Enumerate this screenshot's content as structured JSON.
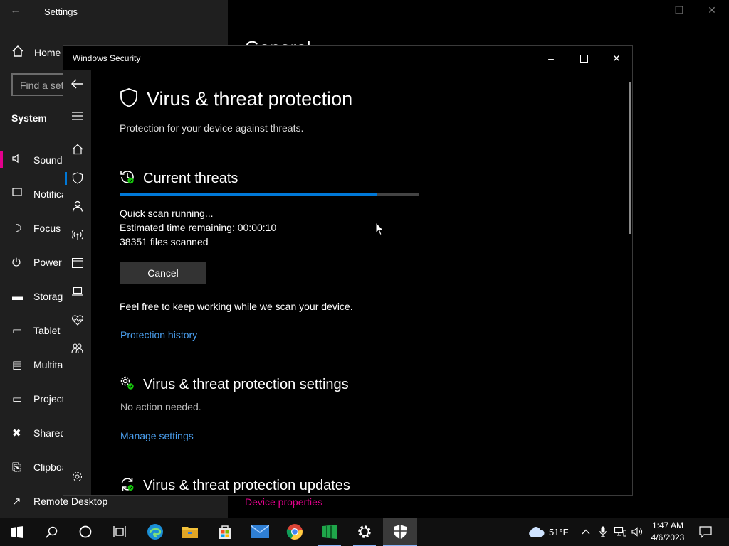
{
  "settings": {
    "title": "Settings",
    "home_label": "Home",
    "search_placeholder": "Find a setting",
    "system_heading": "System",
    "heading_peek": "General",
    "items": [
      {
        "label": "Sound",
        "icon": "speaker-icon"
      },
      {
        "label": "Notifications & actions",
        "icon": "notification-icon"
      },
      {
        "label": "Focus assist",
        "icon": "moon-icon"
      },
      {
        "label": "Power & sleep",
        "icon": "power-icon"
      },
      {
        "label": "Storage",
        "icon": "storage-icon"
      },
      {
        "label": "Tablet",
        "icon": "tablet-icon"
      },
      {
        "label": "Multitasking",
        "icon": "multitasking-icon"
      },
      {
        "label": "Projecting to this PC",
        "icon": "projecting-icon"
      },
      {
        "label": "Shared experiences",
        "icon": "shared-icon"
      },
      {
        "label": "Clipboard",
        "icon": "clipboard-icon"
      },
      {
        "label": "Remote Desktop",
        "icon": "remote-desktop-icon"
      }
    ],
    "device_properties_link": "Device properties",
    "accent_color": "#e3008c"
  },
  "security": {
    "window_title": "Windows Security",
    "page_title": "Virus & threat protection",
    "page_subtitle": "Protection for your device against threats.",
    "current_threats": {
      "heading": "Current threats",
      "progress_fraction": 0.86,
      "status": "Quick scan running...",
      "time_remaining": "Estimated time remaining:  00:00:10",
      "files_scanned": "38351  files scanned",
      "cancel_label": "Cancel",
      "note": "Feel free to keep working while we scan your device.",
      "history_link": "Protection history"
    },
    "settings_section": {
      "heading": "Virus & threat protection settings",
      "status": "No action needed.",
      "link": "Manage settings"
    },
    "updates_section": {
      "heading": "Virus & threat protection updates"
    },
    "accent_color": "#0078d7",
    "link_color": "#4ba0f0"
  },
  "taskbar": {
    "temperature": "51°F",
    "time": "1:47 AM",
    "date": "4/6/2023"
  }
}
